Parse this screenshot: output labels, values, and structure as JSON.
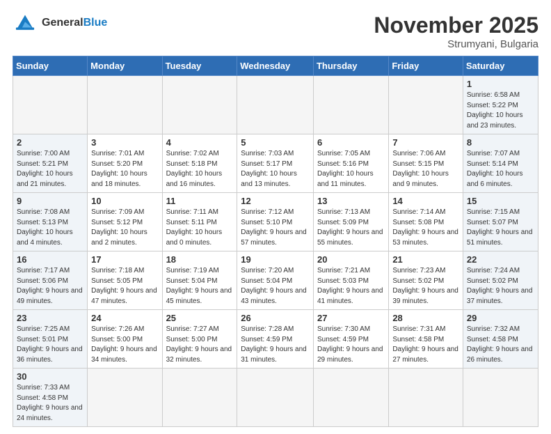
{
  "header": {
    "logo_general": "General",
    "logo_blue": "Blue",
    "month_title": "November 2025",
    "subtitle": "Strumyani, Bulgaria"
  },
  "days_of_week": [
    "Sunday",
    "Monday",
    "Tuesday",
    "Wednesday",
    "Thursday",
    "Friday",
    "Saturday"
  ],
  "weeks": [
    [
      {
        "day": "",
        "info": "",
        "type": "empty"
      },
      {
        "day": "",
        "info": "",
        "type": "empty"
      },
      {
        "day": "",
        "info": "",
        "type": "empty"
      },
      {
        "day": "",
        "info": "",
        "type": "empty"
      },
      {
        "day": "",
        "info": "",
        "type": "empty"
      },
      {
        "day": "",
        "info": "",
        "type": "empty"
      },
      {
        "day": "1",
        "info": "Sunrise: 6:58 AM\nSunset: 5:22 PM\nDaylight: 10 hours and 23 minutes.",
        "type": "weekend"
      }
    ],
    [
      {
        "day": "2",
        "info": "Sunrise: 7:00 AM\nSunset: 5:21 PM\nDaylight: 10 hours and 21 minutes.",
        "type": "weekend"
      },
      {
        "day": "3",
        "info": "Sunrise: 7:01 AM\nSunset: 5:20 PM\nDaylight: 10 hours and 18 minutes.",
        "type": "normal"
      },
      {
        "day": "4",
        "info": "Sunrise: 7:02 AM\nSunset: 5:18 PM\nDaylight: 10 hours and 16 minutes.",
        "type": "normal"
      },
      {
        "day": "5",
        "info": "Sunrise: 7:03 AM\nSunset: 5:17 PM\nDaylight: 10 hours and 13 minutes.",
        "type": "normal"
      },
      {
        "day": "6",
        "info": "Sunrise: 7:05 AM\nSunset: 5:16 PM\nDaylight: 10 hours and 11 minutes.",
        "type": "normal"
      },
      {
        "day": "7",
        "info": "Sunrise: 7:06 AM\nSunset: 5:15 PM\nDaylight: 10 hours and 9 minutes.",
        "type": "normal"
      },
      {
        "day": "8",
        "info": "Sunrise: 7:07 AM\nSunset: 5:14 PM\nDaylight: 10 hours and 6 minutes.",
        "type": "weekend"
      }
    ],
    [
      {
        "day": "9",
        "info": "Sunrise: 7:08 AM\nSunset: 5:13 PM\nDaylight: 10 hours and 4 minutes.",
        "type": "weekend"
      },
      {
        "day": "10",
        "info": "Sunrise: 7:09 AM\nSunset: 5:12 PM\nDaylight: 10 hours and 2 minutes.",
        "type": "normal"
      },
      {
        "day": "11",
        "info": "Sunrise: 7:11 AM\nSunset: 5:11 PM\nDaylight: 10 hours and 0 minutes.",
        "type": "normal"
      },
      {
        "day": "12",
        "info": "Sunrise: 7:12 AM\nSunset: 5:10 PM\nDaylight: 9 hours and 57 minutes.",
        "type": "normal"
      },
      {
        "day": "13",
        "info": "Sunrise: 7:13 AM\nSunset: 5:09 PM\nDaylight: 9 hours and 55 minutes.",
        "type": "normal"
      },
      {
        "day": "14",
        "info": "Sunrise: 7:14 AM\nSunset: 5:08 PM\nDaylight: 9 hours and 53 minutes.",
        "type": "normal"
      },
      {
        "day": "15",
        "info": "Sunrise: 7:15 AM\nSunset: 5:07 PM\nDaylight: 9 hours and 51 minutes.",
        "type": "weekend"
      }
    ],
    [
      {
        "day": "16",
        "info": "Sunrise: 7:17 AM\nSunset: 5:06 PM\nDaylight: 9 hours and 49 minutes.",
        "type": "weekend"
      },
      {
        "day": "17",
        "info": "Sunrise: 7:18 AM\nSunset: 5:05 PM\nDaylight: 9 hours and 47 minutes.",
        "type": "normal"
      },
      {
        "day": "18",
        "info": "Sunrise: 7:19 AM\nSunset: 5:04 PM\nDaylight: 9 hours and 45 minutes.",
        "type": "normal"
      },
      {
        "day": "19",
        "info": "Sunrise: 7:20 AM\nSunset: 5:04 PM\nDaylight: 9 hours and 43 minutes.",
        "type": "normal"
      },
      {
        "day": "20",
        "info": "Sunrise: 7:21 AM\nSunset: 5:03 PM\nDaylight: 9 hours and 41 minutes.",
        "type": "normal"
      },
      {
        "day": "21",
        "info": "Sunrise: 7:23 AM\nSunset: 5:02 PM\nDaylight: 9 hours and 39 minutes.",
        "type": "normal"
      },
      {
        "day": "22",
        "info": "Sunrise: 7:24 AM\nSunset: 5:02 PM\nDaylight: 9 hours and 37 minutes.",
        "type": "weekend"
      }
    ],
    [
      {
        "day": "23",
        "info": "Sunrise: 7:25 AM\nSunset: 5:01 PM\nDaylight: 9 hours and 36 minutes.",
        "type": "weekend"
      },
      {
        "day": "24",
        "info": "Sunrise: 7:26 AM\nSunset: 5:00 PM\nDaylight: 9 hours and 34 minutes.",
        "type": "normal"
      },
      {
        "day": "25",
        "info": "Sunrise: 7:27 AM\nSunset: 5:00 PM\nDaylight: 9 hours and 32 minutes.",
        "type": "normal"
      },
      {
        "day": "26",
        "info": "Sunrise: 7:28 AM\nSunset: 4:59 PM\nDaylight: 9 hours and 31 minutes.",
        "type": "normal"
      },
      {
        "day": "27",
        "info": "Sunrise: 7:30 AM\nSunset: 4:59 PM\nDaylight: 9 hours and 29 minutes.",
        "type": "normal"
      },
      {
        "day": "28",
        "info": "Sunrise: 7:31 AM\nSunset: 4:58 PM\nDaylight: 9 hours and 27 minutes.",
        "type": "normal"
      },
      {
        "day": "29",
        "info": "Sunrise: 7:32 AM\nSunset: 4:58 PM\nDaylight: 9 hours and 26 minutes.",
        "type": "weekend"
      }
    ],
    [
      {
        "day": "30",
        "info": "Sunrise: 7:33 AM\nSunset: 4:58 PM\nDaylight: 9 hours and 24 minutes.",
        "type": "weekend"
      },
      {
        "day": "",
        "info": "",
        "type": "empty"
      },
      {
        "day": "",
        "info": "",
        "type": "empty"
      },
      {
        "day": "",
        "info": "",
        "type": "empty"
      },
      {
        "day": "",
        "info": "",
        "type": "empty"
      },
      {
        "day": "",
        "info": "",
        "type": "empty"
      },
      {
        "day": "",
        "info": "",
        "type": "empty"
      }
    ]
  ]
}
